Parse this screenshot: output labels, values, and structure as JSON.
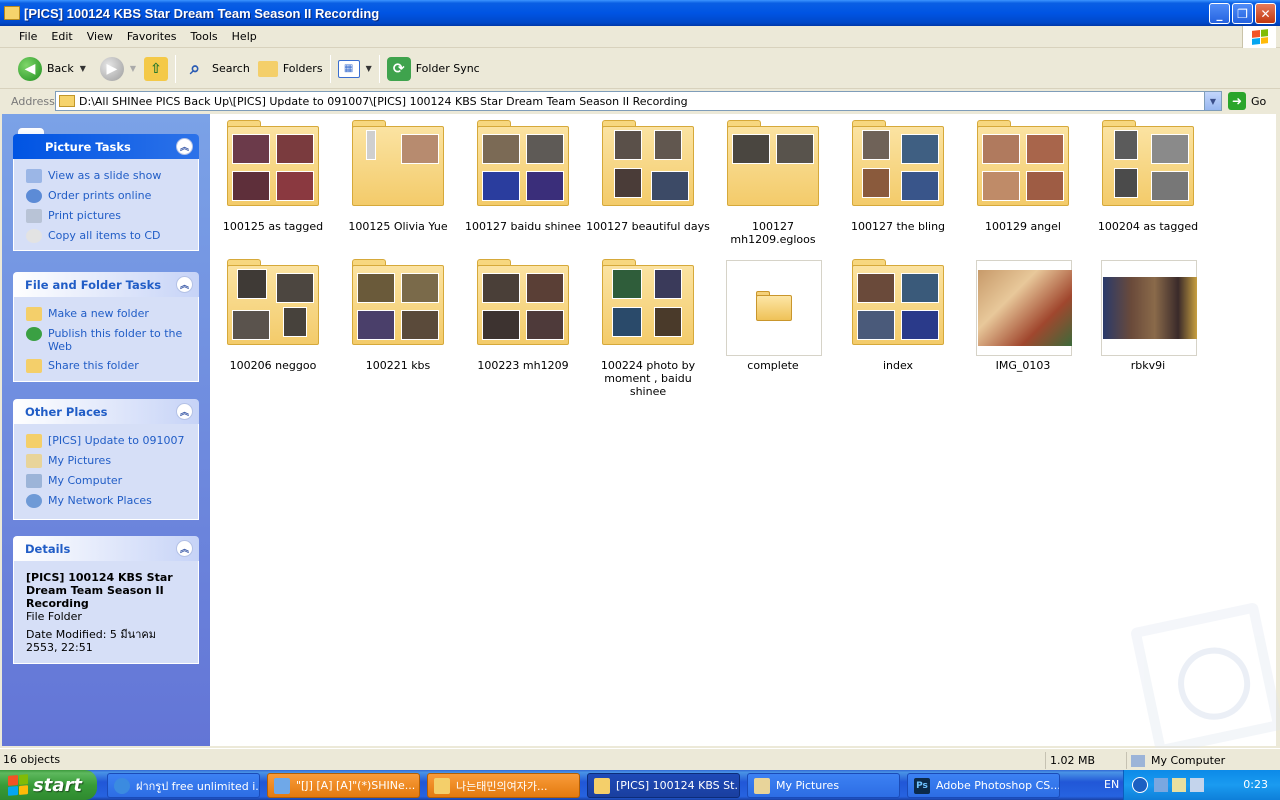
{
  "window": {
    "title": "[PICS] 100124 KBS Star Dream Team Season II Recording",
    "buttons": {
      "minimize": "_",
      "maximize": "❐",
      "close": "✕"
    }
  },
  "menu": [
    "File",
    "Edit",
    "View",
    "Favorites",
    "Tools",
    "Help"
  ],
  "toolbar": {
    "back": "Back",
    "search": "Search",
    "folders": "Folders",
    "folder_sync": "Folder Sync"
  },
  "address": {
    "label": "Address",
    "path": "D:\\All SHINee PICS Back Up\\[PICS] Update to 091007\\[PICS] 100124 KBS Star Dream Team Season II Recording",
    "go": "Go"
  },
  "panels": {
    "picture_tasks": {
      "title": "Picture Tasks",
      "items": [
        "View as a slide show",
        "Order prints online",
        "Print pictures",
        "Copy all items to CD"
      ]
    },
    "file_folder_tasks": {
      "title": "File and Folder Tasks",
      "items": [
        "Make a new folder",
        "Publish this folder to the Web",
        "Share this folder"
      ]
    },
    "other_places": {
      "title": "Other Places",
      "items": [
        "[PICS] Update to 091007",
        "My Pictures",
        "My Computer",
        "My Network Places"
      ]
    },
    "details": {
      "title": "Details",
      "name": "[PICS] 100124 KBS Star Dream Team Season II Recording",
      "type": "File Folder",
      "modified": "Date Modified: 5 มีนาคม 2553, 22:51"
    }
  },
  "files": [
    "100125 as tagged",
    "100125 Olivia Yue",
    "100127 baidu shinee",
    "100127 beautiful days",
    "100127 mh1209.egloos",
    "100127 the bling",
    "100129 angel",
    "100204 as tagged",
    "100206 neggoo",
    "100221 kbs",
    "100223 mh1209",
    "100224 photo by moment , baidu shinee",
    "complete",
    "index",
    "IMG_0103",
    "rbkv9i"
  ],
  "status": {
    "objects": "16 objects",
    "size": "1.02 MB",
    "location": "My Computer"
  },
  "taskbar": {
    "start": "start",
    "tasks": [
      "ฝากรูป free unlimited i...",
      "\"[J] [A] [A]\"(*)SHINe...",
      "나는태민의여자가...",
      "[PICS] 100124 KBS St...",
      "My Pictures",
      "Adobe Photoshop CS..."
    ],
    "lang": "EN",
    "clock": "0:23"
  }
}
